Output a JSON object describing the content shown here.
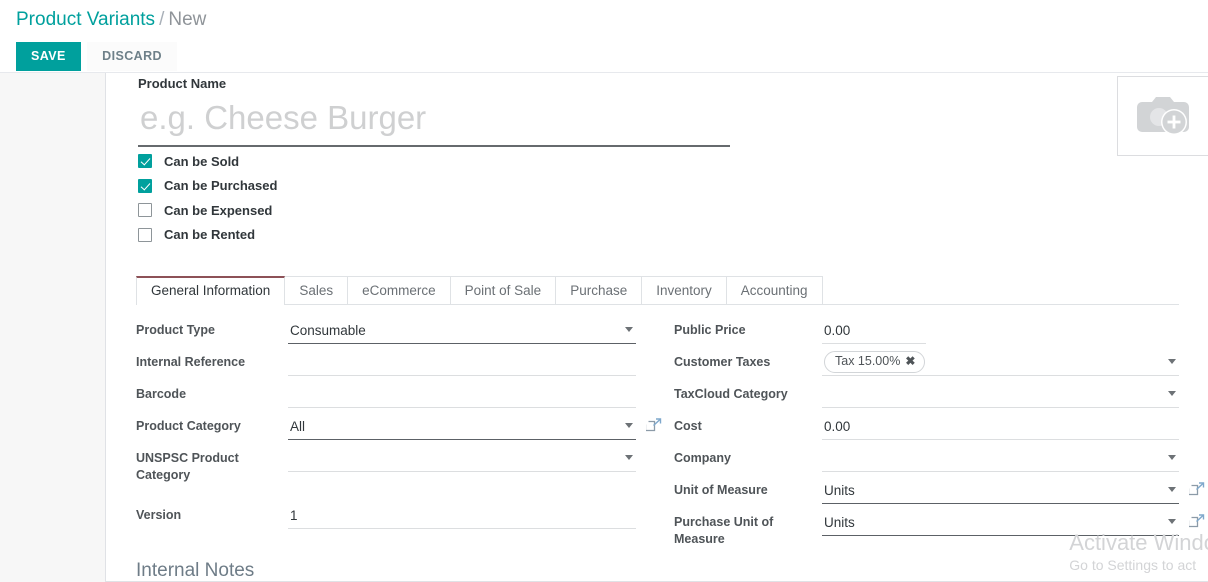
{
  "breadcrumb": {
    "parent": "Product Variants",
    "separator": "/",
    "current": "New"
  },
  "toolbar": {
    "save_label": "SAVE",
    "discard_label": "DISCARD",
    "save_color": "#00a09d"
  },
  "form": {
    "title_label": "Product Name",
    "name_placeholder": "e.g. Cheese Burger",
    "name_value": "",
    "image_icon": "camera-add-icon",
    "checkboxes": [
      {
        "label": "Can be Sold",
        "checked": true
      },
      {
        "label": "Can be Purchased",
        "checked": true
      },
      {
        "label": "Can be Expensed",
        "checked": false
      },
      {
        "label": "Can be Rented",
        "checked": false
      }
    ]
  },
  "tabs": [
    {
      "label": "General Information",
      "active": true
    },
    {
      "label": "Sales",
      "active": false
    },
    {
      "label": "eCommerce",
      "active": false
    },
    {
      "label": "Point of Sale",
      "active": false
    },
    {
      "label": "Purchase",
      "active": false
    },
    {
      "label": "Inventory",
      "active": false
    },
    {
      "label": "Accounting",
      "active": false
    }
  ],
  "fields_left": [
    {
      "label": "Product Type",
      "value": "Consumable",
      "caret": true,
      "filled": true,
      "link": false
    },
    {
      "label": "Internal Reference",
      "value": "",
      "caret": false,
      "filled": false,
      "link": false
    },
    {
      "label": "Barcode",
      "value": "",
      "caret": false,
      "filled": false,
      "link": false
    },
    {
      "label": "Product Category",
      "value": "All",
      "caret": true,
      "filled": true,
      "link": true
    },
    {
      "label": "UNSPSC Product Category",
      "value": "",
      "caret": true,
      "filled": false,
      "link": false
    },
    {
      "label": "Version",
      "value": "1",
      "caret": false,
      "filled": false,
      "link": false
    }
  ],
  "fields_right": [
    {
      "label": "Public Price",
      "value": "0.00",
      "caret": false,
      "filled": false,
      "link": false,
      "short": true
    },
    {
      "label": "Customer Taxes",
      "value": "",
      "caret": true,
      "filled": false,
      "link": false,
      "tag": "Tax 15.00%",
      "tag_remove": "✖"
    },
    {
      "label": "TaxCloud Category",
      "value": "",
      "caret": true,
      "filled": false,
      "link": false
    },
    {
      "label": "Cost",
      "value": "0.00",
      "caret": false,
      "filled": false,
      "link": false
    },
    {
      "label": "Company",
      "value": "",
      "caret": true,
      "filled": false,
      "link": false
    },
    {
      "label": "Unit of Measure",
      "value": "Units",
      "caret": true,
      "filled": true,
      "link": true
    },
    {
      "label": "Purchase Unit of Measure",
      "value": "Units",
      "caret": true,
      "filled": true,
      "link": true
    }
  ],
  "notes": {
    "title": "Internal Notes"
  },
  "watermark": {
    "line1": "Activate Windo",
    "line2": "Go to Settings to act"
  },
  "colors": {
    "accent": "#00a09d",
    "active_tab_border": "#8d5157",
    "label": "#4f5458",
    "page_bg": "#f7f7f7"
  }
}
